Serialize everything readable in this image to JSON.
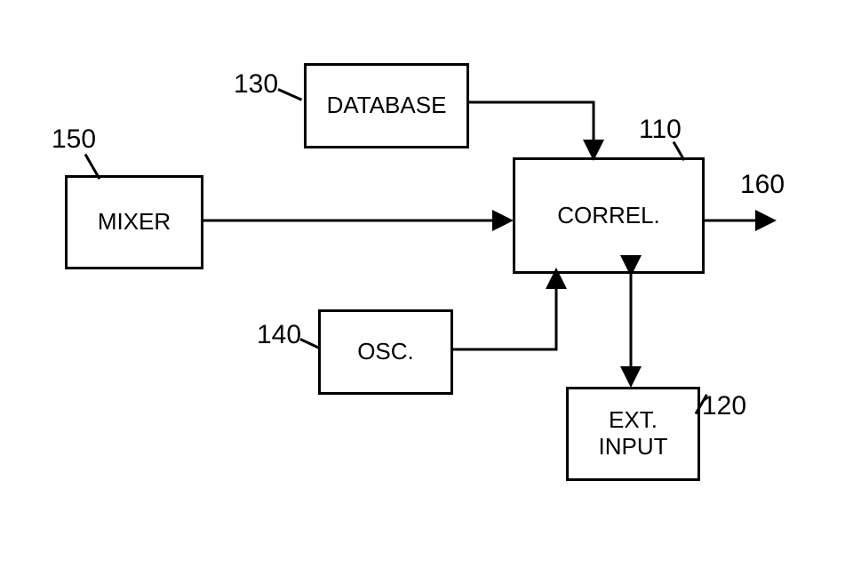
{
  "blocks": {
    "mixer": {
      "label": "MIXER",
      "ref": "150"
    },
    "database": {
      "label": "DATABASE",
      "ref": "130"
    },
    "osc": {
      "label": "OSC.",
      "ref": "140"
    },
    "correl": {
      "label": "CORREL.",
      "ref": "110"
    },
    "ext_input": {
      "label": "EXT.\nINPUT",
      "ref": "120"
    },
    "output": {
      "ref": "160"
    }
  }
}
